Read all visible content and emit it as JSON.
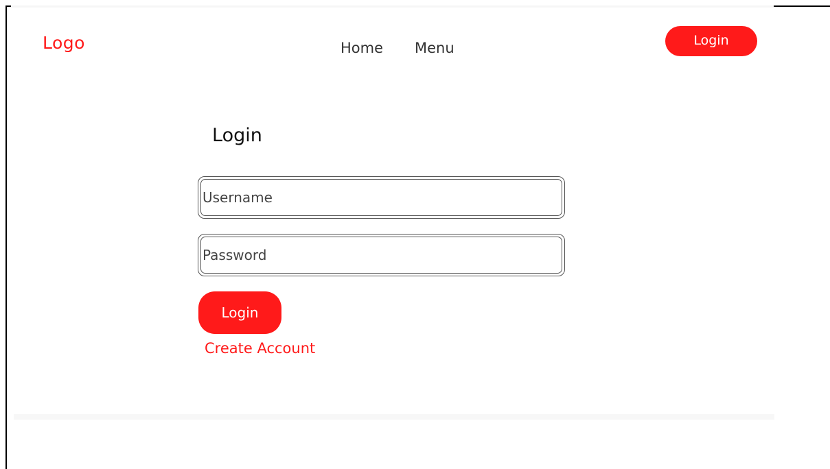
{
  "colors": {
    "accent": "#ff1a1a",
    "text": "#333333",
    "heading": "#111111"
  },
  "header": {
    "logo_text": "Logo",
    "nav": [
      {
        "label": "Home"
      },
      {
        "label": "Menu"
      }
    ],
    "login_label": "Login"
  },
  "form": {
    "title": "Login",
    "username": {
      "placeholder": "Username",
      "value": ""
    },
    "password": {
      "placeholder": "Password",
      "value": ""
    },
    "submit_label": "Login",
    "create_account_label": "Create Account"
  }
}
